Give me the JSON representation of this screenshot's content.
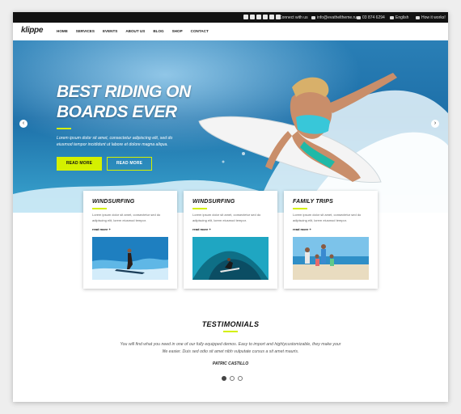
{
  "topbar": {
    "connect_label": "Connect with us",
    "email": "info@evatheltheme.ru",
    "phone": "03 874 6294",
    "language": "English",
    "how_it_works": "How it works!"
  },
  "nav": {
    "logo": "klippe",
    "items": [
      "HOME",
      "SERVICES",
      "EVENTS",
      "ABOUT US",
      "BLOG",
      "SHOP",
      "CONTACT"
    ]
  },
  "hero": {
    "title": "BEST RIDING ON BOARDS EVER",
    "text": "Lorem ipsum dolor sit amet, consectetur adipiscing elit, sed do eiusmod tempor incididunt ut labore et dolore magna aliqua.",
    "button_primary": "READ MORE",
    "button_secondary": "READ MORE"
  },
  "cards": [
    {
      "title": "WINDSURFING",
      "text": "Lorem ipsum dolor sit amet, consectetur sed do adipiscing elit, lorem eiusmod tempor.",
      "more": "read more +"
    },
    {
      "title": "WINDSURFING",
      "text": "Lorem ipsum dolor sit amet, consectetur sed do adipiscing elit, lorem eiusmod tempor.",
      "more": "read more +"
    },
    {
      "title": "FAMILY TRIPS",
      "text": "Lorem ipsum dolor sit amet, consectetur sed do adipiscing elit, lorem eiusmod tempor.",
      "more": "read more +"
    }
  ],
  "testimonials": {
    "title": "TESTIMONIALS",
    "quote": "You will find what you need in one of our fully equipped demos. Easy to import and highlycustomizable, they make your life easier. Duis sed odio sit amet nibh vulputate cursus a sit amet mauris.",
    "author": "PATRIC CASTILLO"
  },
  "colors": {
    "accent": "#d4f000",
    "topbar": "#111111"
  }
}
